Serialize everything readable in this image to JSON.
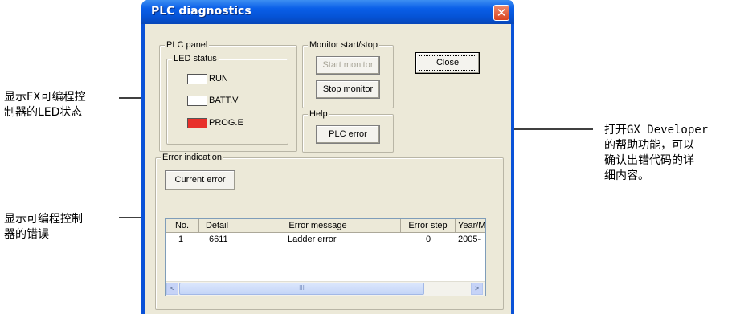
{
  "annotations": {
    "led": [
      "显示FX可编程控",
      "制器的LED状态"
    ],
    "error": [
      "显示可编程控制",
      "器的错误"
    ],
    "help": [
      "打开GX Developer",
      "的帮助功能，可以",
      "确认出错代码的详",
      "细内容。"
    ]
  },
  "window": {
    "title": "PLC diagnostics",
    "close_glyph": "✕"
  },
  "plc_panel": {
    "label": "PLC panel",
    "led_status_label": "LED status",
    "leds": [
      {
        "label": "RUN",
        "color": "#ffffff"
      },
      {
        "label": "BATT.V",
        "color": "#ffffff"
      },
      {
        "label": "PROG.E",
        "color": "#e8302a"
      }
    ]
  },
  "monitor": {
    "label": "Monitor start/stop",
    "start_label": "Start monitor",
    "stop_label": "Stop monitor"
  },
  "close_button": "Close",
  "help": {
    "label": "Help",
    "plc_error_label": "PLC error"
  },
  "error_indication": {
    "label": "Error indication",
    "current_error_label": "Current error",
    "columns": [
      "No.",
      "Detail",
      "Error message",
      "Error step",
      "Year/M"
    ],
    "rows": [
      {
        "no": "1",
        "detail": "6611",
        "message": "Ladder error",
        "step": "0",
        "year": "2005-"
      }
    ],
    "scroll_left": "<",
    "scroll_right": ">",
    "thumb_grip": "III"
  },
  "colors": {
    "title_bar": "#0553d6",
    "dialog_bg": "#ece9d8",
    "led_error": "#e8302a"
  }
}
